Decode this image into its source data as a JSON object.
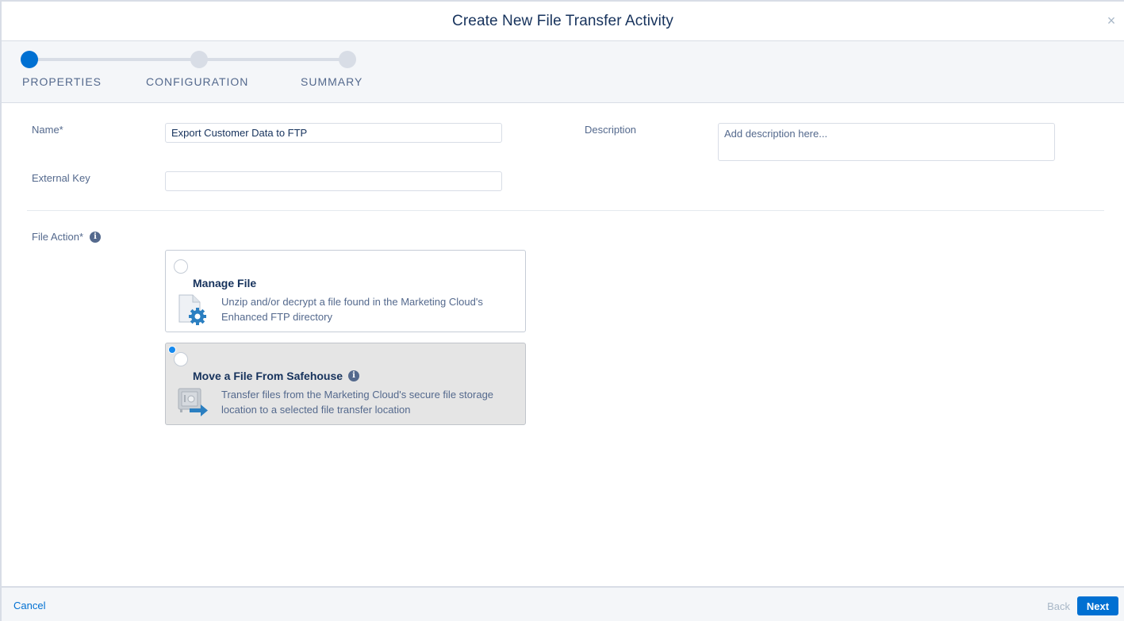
{
  "header": {
    "title": "Create New File Transfer Activity",
    "close_symbol": "×"
  },
  "steps": [
    {
      "label": "PROPERTIES",
      "state": "active"
    },
    {
      "label": "CONFIGURATION",
      "state": "pending"
    },
    {
      "label": "SUMMARY",
      "state": "pending"
    }
  ],
  "form": {
    "name_label": "Name*",
    "name_value": "Export Customer Data to FTP",
    "external_key_label": "External Key",
    "external_key_value": "",
    "description_label": "Description",
    "description_placeholder": "Add description here...",
    "file_action_label": "File Action*"
  },
  "file_actions": [
    {
      "title": "Manage File",
      "description": "Unzip and/or decrypt a file found in the Marketing Cloud's Enhanced FTP directory",
      "selected": false,
      "icon": "file-gear-icon"
    },
    {
      "title": "Move a File From Safehouse",
      "description": "Transfer files from the Marketing Cloud's secure file storage location to a selected file transfer location",
      "selected": true,
      "icon": "safe-arrow-icon"
    }
  ],
  "info_glyph": "i",
  "footer": {
    "cancel_label": "Cancel",
    "back_label": "Back",
    "next_label": "Next"
  },
  "colors": {
    "brand": "#0070d2",
    "text": "#16325c",
    "muted": "#54698d",
    "border": "#d8dde6"
  }
}
